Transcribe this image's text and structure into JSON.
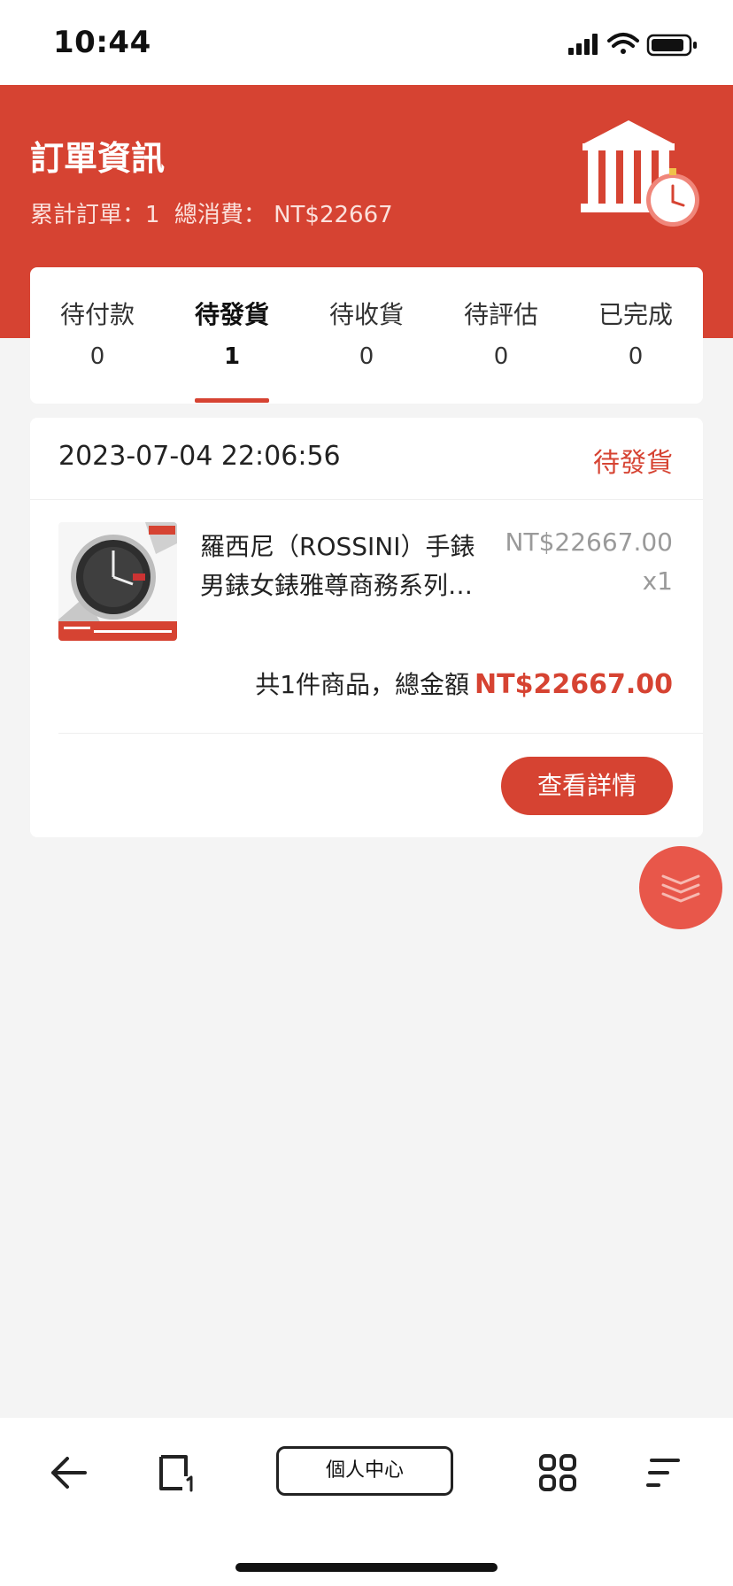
{
  "status_bar": {
    "time": "10:44"
  },
  "header": {
    "title": "訂單資訊",
    "summary_orders": "累計訂單：1",
    "summary_spend": "總消費： NT$22667"
  },
  "tabs": [
    {
      "label": "待付款",
      "count": "0"
    },
    {
      "label": "待發貨",
      "count": "1"
    },
    {
      "label": "待收貨",
      "count": "0"
    },
    {
      "label": "待評估",
      "count": "0"
    },
    {
      "label": "已完成",
      "count": "0"
    }
  ],
  "active_tab": "待發貨",
  "order": {
    "datetime": "2023-07-04 22:06:56",
    "status": "待發貨",
    "product": {
      "name": "羅西尼（ROSSINI）手錶男錶女錶雅尊商務系列…",
      "price": "NT$22667.00",
      "quantity": "x1"
    },
    "summary_text": "共1件商品，總金額",
    "total": "NT$22667.00",
    "detail_button": "查看詳情"
  },
  "bottom_bar": {
    "center_label": "個人中心"
  },
  "icons": {
    "back": "back-arrow-icon",
    "tabs": "tabs-icon",
    "apps": "grid-icon",
    "menu": "menu-icon",
    "float": "layers-icon"
  },
  "colors": {
    "brand": "#d64332",
    "background": "#f4f4f4"
  }
}
